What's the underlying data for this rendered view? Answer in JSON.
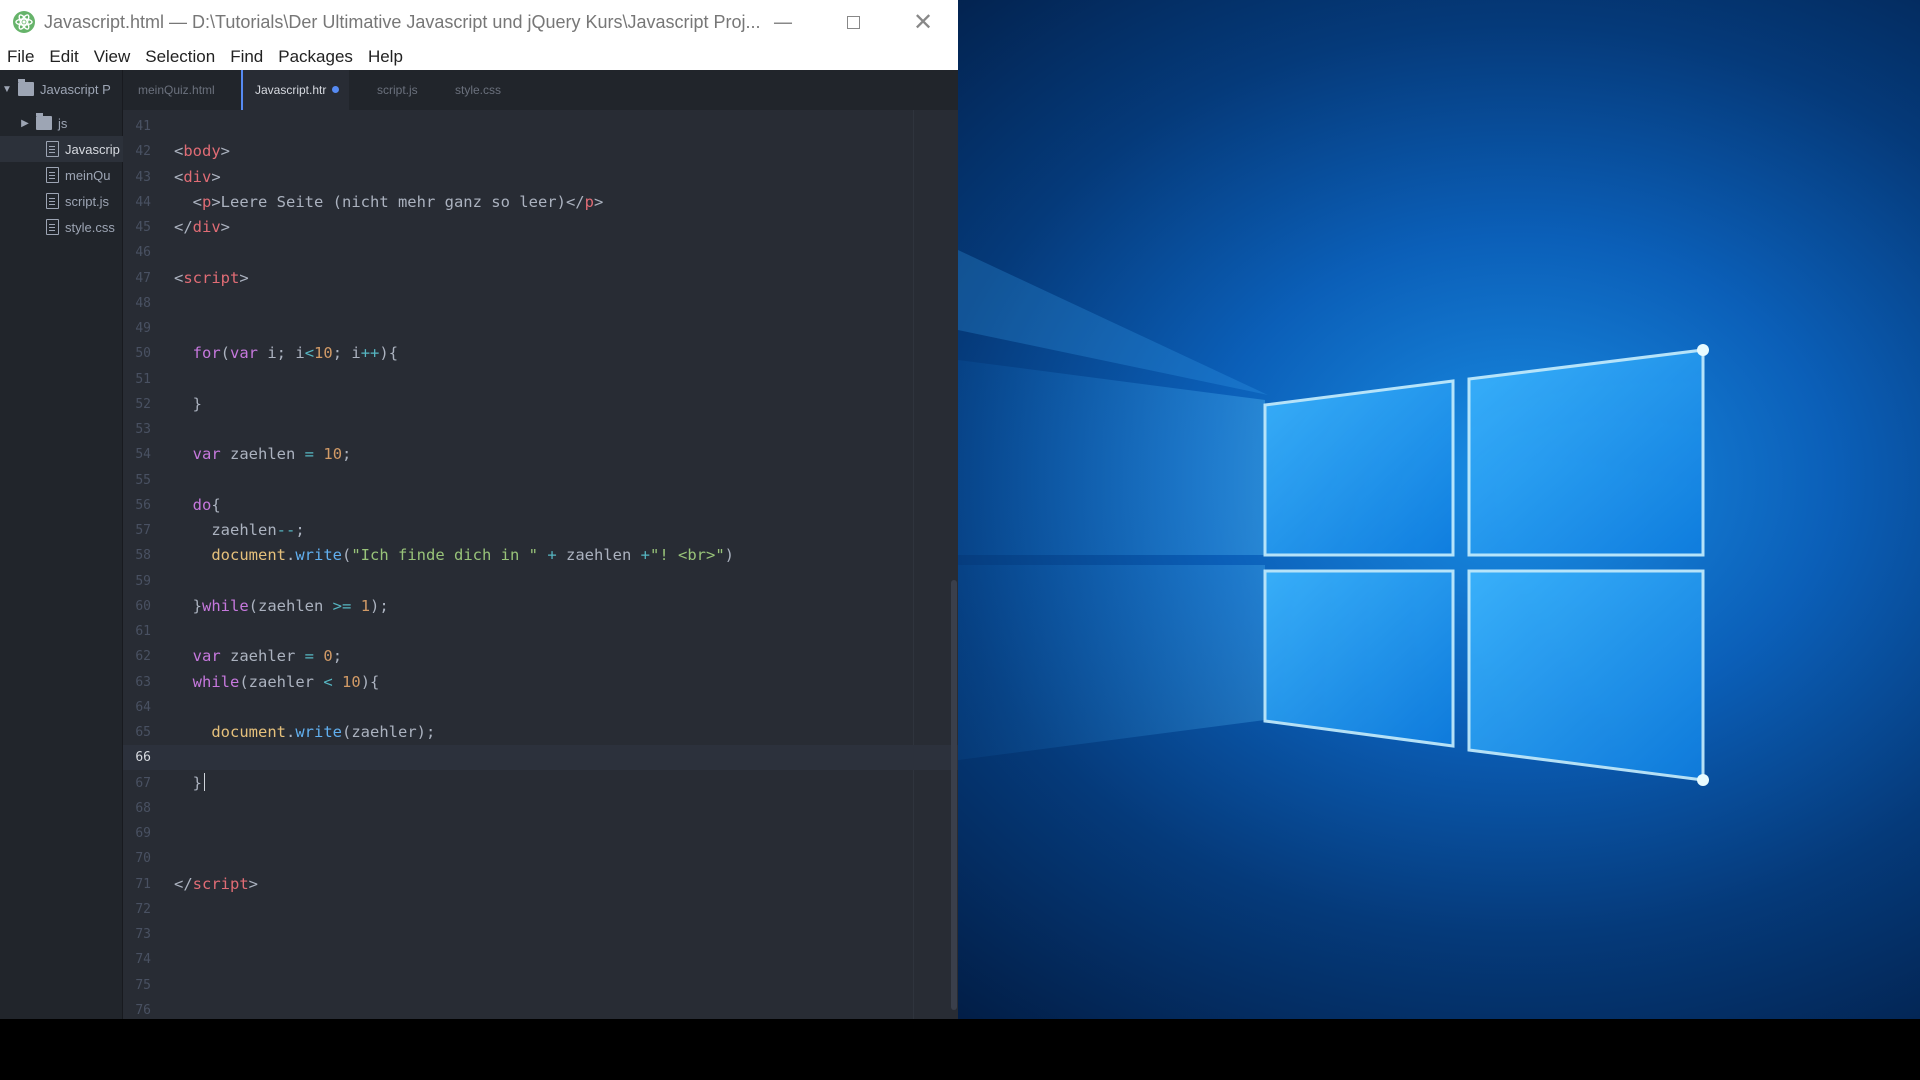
{
  "window": {
    "title": "Javascript.html — D:\\Tutorials\\Der Ultimative Javascript und jQuery Kurs\\Javascript Proj...",
    "minimize_icon": "minimize-icon",
    "maximize_icon": "maximize-icon",
    "close_icon": "close-icon"
  },
  "menu": [
    "File",
    "Edit",
    "View",
    "Selection",
    "Find",
    "Packages",
    "Help"
  ],
  "tree": {
    "root": "Javascript P",
    "items": [
      {
        "label": "js",
        "type": "folder"
      },
      {
        "label": "Javascrip",
        "type": "file",
        "selected": true
      },
      {
        "label": "meinQu",
        "type": "file"
      },
      {
        "label": "script.js",
        "type": "file"
      },
      {
        "label": "style.css",
        "type": "file"
      }
    ]
  },
  "tabs": [
    {
      "label": "meinQuiz.html",
      "active": false
    },
    {
      "label": "Javascript.htr",
      "active": true,
      "modified": true
    },
    {
      "label": "script.js",
      "active": false
    },
    {
      "label": "style.css",
      "active": false
    }
  ],
  "editor": {
    "current_line": 66,
    "line_numbers": [
      "41",
      "42",
      "43",
      "44",
      "45",
      "46",
      "47",
      "48",
      "49",
      "50",
      "51",
      "52",
      "53",
      "54",
      "55",
      "56",
      "57",
      "58",
      "59",
      "60",
      "61",
      "62",
      "63",
      "64",
      "65",
      "66",
      "67",
      "68",
      "69",
      "70",
      "71",
      "72",
      "73",
      "74",
      "75",
      "76"
    ],
    "code": {
      "l42": [
        "<",
        "body",
        ">"
      ],
      "l43": [
        "<",
        "div",
        ">"
      ],
      "l44": [
        "  <",
        "p",
        ">Leere Seite (nicht mehr ganz so leer)</",
        "p",
        ">"
      ],
      "l45": [
        "</",
        "div",
        ">"
      ],
      "l47": [
        "<",
        "script",
        ">"
      ],
      "l50": [
        "  ",
        "for",
        "(",
        "var",
        " i; i",
        "<",
        "10",
        "; i",
        "++",
        "){"
      ],
      "l52": [
        "  }"
      ],
      "l54": [
        "  ",
        "var",
        " zaehlen ",
        "=",
        " ",
        "10",
        ";"
      ],
      "l56": [
        "  ",
        "do",
        "{"
      ],
      "l57": [
        "    zaehlen",
        "--",
        ";"
      ],
      "l58": [
        "    ",
        "document",
        ".",
        "write",
        "(",
        "\"Ich finde dich in \"",
        " ",
        "+",
        " zaehlen ",
        "+",
        "\"! <br>\"",
        ")"
      ],
      "l60": [
        "  }",
        "while",
        "(zaehlen ",
        ">=",
        " ",
        "1",
        ");"
      ],
      "l62": [
        "  ",
        "var",
        " zaehler ",
        "=",
        " ",
        "0",
        ";"
      ],
      "l63": [
        "  ",
        "while",
        "(zaehler ",
        "<",
        " ",
        "10",
        "){"
      ],
      "l65": [
        "    ",
        "document",
        ".",
        "write",
        "(zaehler);"
      ],
      "l67": [
        "  }"
      ],
      "l71": [
        "</",
        "script",
        ">"
      ]
    }
  },
  "colors": {
    "tag": "#e06c75",
    "keyword": "#c678dd",
    "number": "#d19a66",
    "string": "#98c379",
    "function": "#61afef",
    "operator": "#56b6c2",
    "editor_bg": "#282c34",
    "accent": "#568af2"
  }
}
